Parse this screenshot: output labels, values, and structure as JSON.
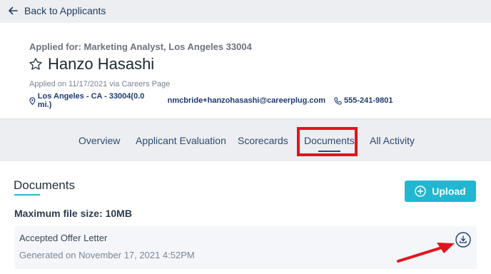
{
  "back_link": {
    "label": "Back to Applicants",
    "icon": "arrow-left-icon"
  },
  "applicant": {
    "applied_for": "Applied for: Marketing Analyst, Los Angeles 33004",
    "name": "Hanzo Hasashi",
    "applied_on": "Applied on 11/17/2021 via Careers Page",
    "location": "Los Angeles - CA - 33004(0.0 mi.)",
    "email": "nmcbride+hanzohasashi@careerplug.com",
    "phone": "555-241-9801"
  },
  "tabs": [
    {
      "label": "Overview"
    },
    {
      "label": "Applicant Evaluation"
    },
    {
      "label": "Scorecards"
    },
    {
      "label": "Documents",
      "active": true
    },
    {
      "label": "All Activity"
    }
  ],
  "documents": {
    "title": "Documents",
    "upload_label": "Upload",
    "max_size": "Maximum file size: 10MB",
    "items": [
      {
        "name": "Accepted Offer Letter",
        "generated": "Generated on November 17, 2021 4:52PM"
      }
    ]
  },
  "colors": {
    "accent": "#21b7d1",
    "navy": "#1e3a70",
    "highlight": "#e1141d",
    "page_bg": "#eceef1"
  }
}
